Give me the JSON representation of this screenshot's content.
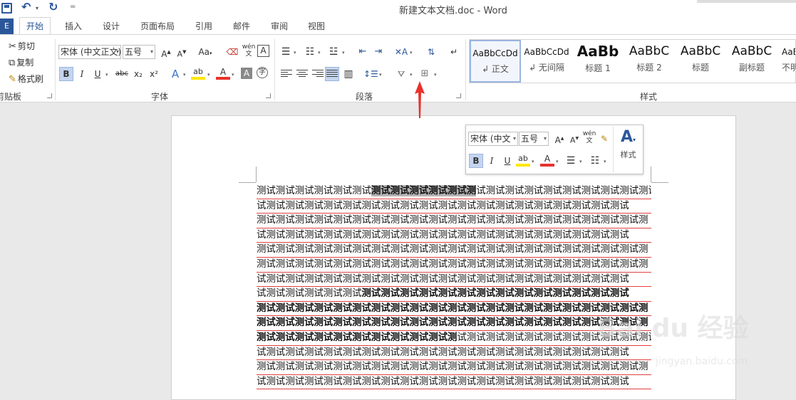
{
  "window": {
    "title": "新建文本文档.doc - Word"
  },
  "qat": {
    "save_icon": "save-icon",
    "undo_icon": "undo-icon",
    "redo_icon": "redo-icon",
    "more": "="
  },
  "tabs": {
    "file": "E",
    "items": [
      {
        "label": "开始",
        "active": true
      },
      {
        "label": "插入"
      },
      {
        "label": "设计"
      },
      {
        "label": "页面布局"
      },
      {
        "label": "引用"
      },
      {
        "label": "邮件"
      },
      {
        "label": "审阅"
      },
      {
        "label": "视图"
      }
    ]
  },
  "ribbon": {
    "clipboard": {
      "cut": "剪切",
      "copy": "复制",
      "format_painter": "格式刷",
      "label": "剪贴板"
    },
    "font": {
      "family": "宋体 (中文正文)",
      "size": "五号",
      "label": "字体",
      "bold": "B",
      "italic": "I",
      "underline": "U",
      "strike": "abc",
      "subscript": "x₂",
      "superscript": "x²",
      "grow": "A",
      "shrink": "A",
      "case": "Aa",
      "phonetic": "wén"
    },
    "paragraph": {
      "label": "段落"
    },
    "styles": {
      "label": "样式",
      "items": [
        {
          "sample": "AaBbCcDd",
          "name": "↲ 正文",
          "selected": true
        },
        {
          "sample": "AaBbCcDd",
          "name": "↲ 无间隔"
        },
        {
          "sample": "AaBb",
          "name": "标题 1"
        },
        {
          "sample": "AaBbC",
          "name": "标题 2"
        },
        {
          "sample": "AaBbC",
          "name": "标题"
        },
        {
          "sample": "AaBbC",
          "name": "副标题"
        },
        {
          "sample": "AaBl",
          "name": "不明"
        }
      ]
    }
  },
  "mini_toolbar": {
    "font": "宋体 (中文",
    "size": "五号",
    "bold": "B",
    "italic": "I",
    "underline": "U",
    "styles_label": "样式",
    "phonetic": "wén"
  },
  "document": {
    "lines": [
      {
        "pre": "测试测试测试测试测试测试",
        "hl": "测试测试测试测试测试测",
        "post": "试测试测试测试测试测试测试测试测试测试测试测"
      },
      {
        "text": "试测试测试测试测试测试测试测试测试测试测试测试测试测试测试测试测试测试测试测试"
      },
      {
        "text": "测试测试测试测试测试测试测试测试测试测试测试测试测试测试测试测试测试测试测试测试测"
      },
      {
        "text": "试测试测试测试测试测试测试测试测试测试测试测试测试测试测试测试测试测试测试测试"
      },
      {
        "text": "测试测试测试测试测试测试测试测试测试测试测试测试测试测试测试测试测试测试测试测试测"
      },
      {
        "text": "测试测试测试测试测试测试测试测试测试测试测试测试测试测试测试测试测试测试测试测试测"
      },
      {
        "text": "试测试测试测试测试测试测试测试测试测试测试测试测试测试测试测试测试测试测试测试"
      },
      {
        "pre": "试测试测试测试测试测试",
        "bold": "测试测试测试测试测试测试测试测试测试测试测试测试测试测试"
      },
      {
        "bold": "测试测试测试测试测试测试测试测试测试测试测试测试测试测试测试测试测试测试测试测试测"
      },
      {
        "bold": "测试测试测试测试测试测试测试测试测试测试测试测试测试测试测试测试测试测试测试测试测"
      },
      {
        "bold": "测试测试测试测试测试测试测试测试测试测试测",
        "post": "试测试测试测试测试测试测试测试测试测试测试测"
      },
      {
        "text": "试测试测试测试测试测试测试测试测试测试测试测试测试测试测试测试测试测试测试测试"
      },
      {
        "text": "测试测试测试测试测试测试测试测试测试测试测试测试测试测试测试测试测试测试测试测试测"
      },
      {
        "text": "试测试测试测试测试测试测试测试测试测试测试测试测试测试测试测试测试测试测试测试"
      }
    ]
  },
  "watermark": {
    "text": "Bai du 经验",
    "url": "jingyan.baidu.com"
  },
  "colors": {
    "accent": "#2b579a",
    "arrow": "#e8322c",
    "highlight": "#b4b4b4",
    "spell": "#e04040"
  }
}
